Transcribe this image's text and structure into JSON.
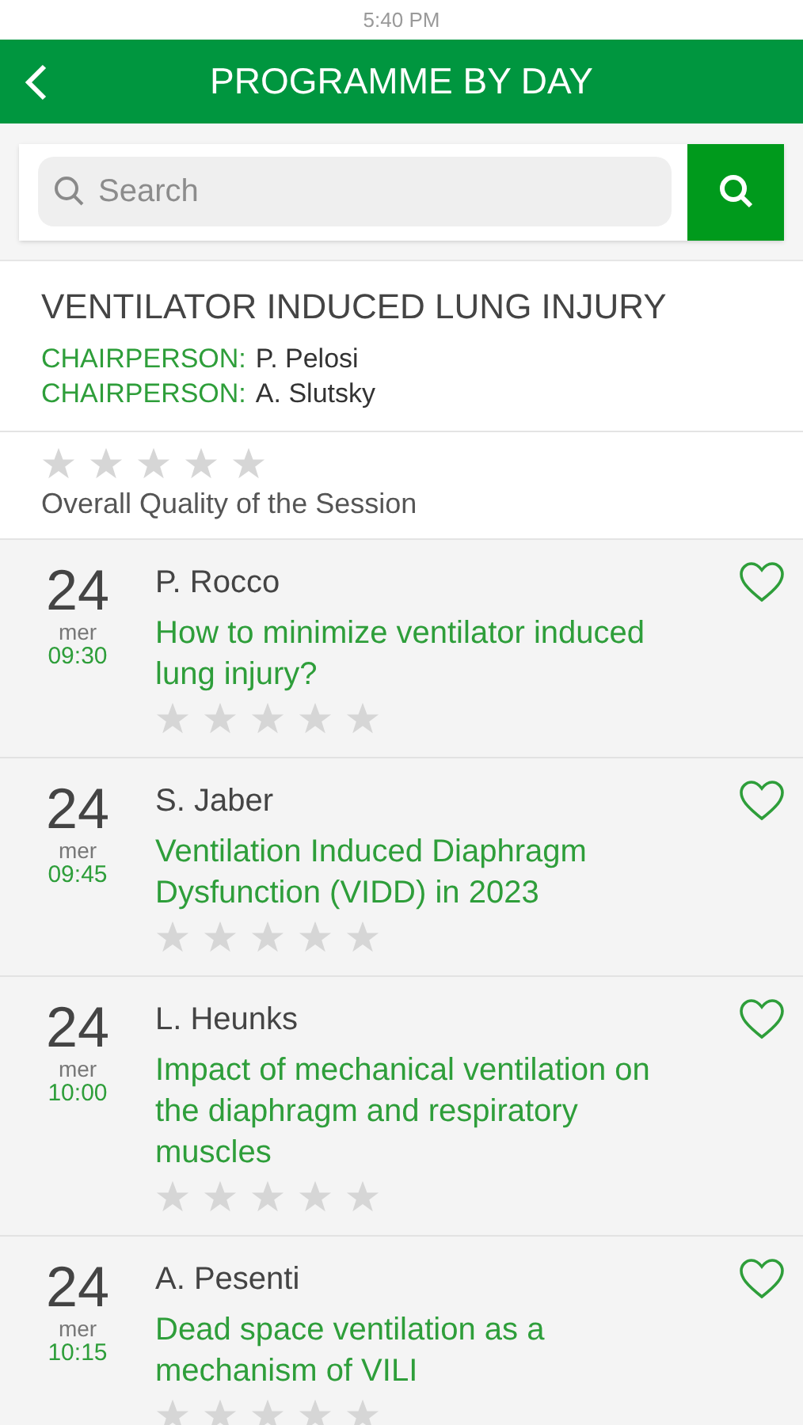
{
  "status_bar": {
    "time": "5:40 PM"
  },
  "header": {
    "title": "PROGRAMME BY DAY"
  },
  "search": {
    "placeholder": "Search"
  },
  "session": {
    "title": "VENTILATOR INDUCED LUNG INJURY",
    "chairs": [
      {
        "label": "CHAIRPERSON:",
        "name": "P. Pelosi"
      },
      {
        "label": "CHAIRPERSON:",
        "name": "A. Slutsky"
      }
    ],
    "stars": 0,
    "rating_label": "Overall Quality of the Session"
  },
  "talks": [
    {
      "day": "24",
      "weekday": "mer",
      "time": "09:30",
      "speaker": "P. Rocco",
      "title": "How to minimize ventilator induced lung injury?",
      "stars": 0,
      "favorite": false
    },
    {
      "day": "24",
      "weekday": "mer",
      "time": "09:45",
      "speaker": "S. Jaber",
      "title": "Ventilation Induced Diaphragm Dysfunction (VIDD) in 2023",
      "stars": 0,
      "favorite": false
    },
    {
      "day": "24",
      "weekday": "mer",
      "time": "10:00",
      "speaker": "L. Heunks",
      "title": "Impact of mechanical ventilation on the diaphragm and respiratory muscles",
      "stars": 0,
      "favorite": false
    },
    {
      "day": "24",
      "weekday": "mer",
      "time": "10:15",
      "speaker": "A. Pesenti",
      "title": "Dead space ventilation as a mechanism of VILI",
      "stars": 0,
      "favorite": false
    }
  ]
}
